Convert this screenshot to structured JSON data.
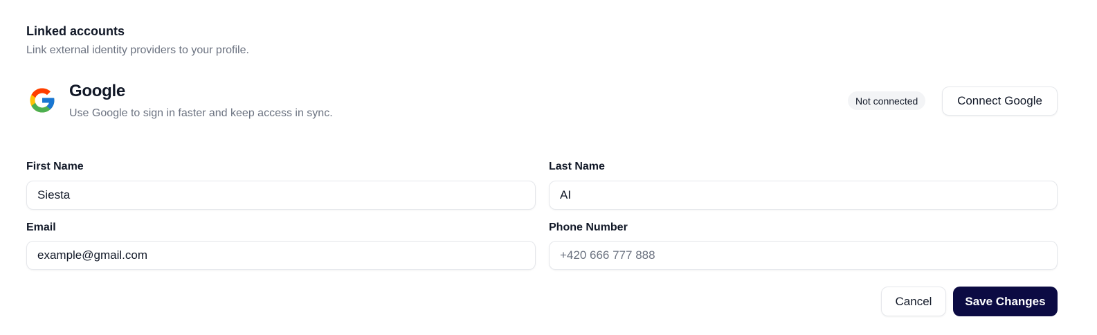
{
  "linked_accounts": {
    "title": "Linked accounts",
    "subtitle": "Link external identity providers to your profile."
  },
  "provider": {
    "icon": "google-icon",
    "name": "Google",
    "description": "Use Google to sign in faster and keep access in sync.",
    "status": "Not connected",
    "connect_label": "Connect Google"
  },
  "form": {
    "first_name": {
      "label": "First Name",
      "value": "Siesta",
      "placeholder": ""
    },
    "last_name": {
      "label": "Last Name",
      "value": "AI",
      "placeholder": ""
    },
    "email": {
      "label": "Email",
      "value": "example@gmail.com",
      "placeholder": ""
    },
    "phone": {
      "label": "Phone Number",
      "value": "",
      "placeholder": "+420 666 777 888"
    }
  },
  "actions": {
    "cancel_label": "Cancel",
    "save_label": "Save Changes"
  },
  "colors": {
    "primary": "#0c0b43",
    "muted_text": "#6b7280",
    "badge_bg": "#f3f4f6",
    "border": "#e5e7eb"
  }
}
